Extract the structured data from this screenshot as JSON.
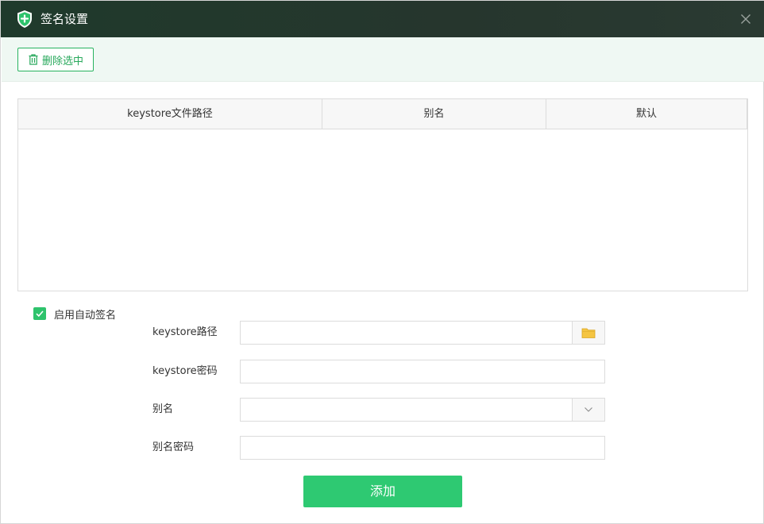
{
  "window": {
    "title": "签名设置"
  },
  "toolbar": {
    "delete_label": "删除选中"
  },
  "table": {
    "columns": [
      "keystore文件路径",
      "别名",
      "默认"
    ],
    "rows": []
  },
  "auto_sign": {
    "label": "启用自动签名",
    "checked": true
  },
  "form": {
    "keystore_path": {
      "label": "keystore路径",
      "value": "",
      "placeholder": ""
    },
    "keystore_password": {
      "label": "keystore密码",
      "value": "",
      "placeholder": ""
    },
    "alias": {
      "label": "别名",
      "selected": ""
    },
    "alias_password": {
      "label": "别名密码",
      "value": "",
      "placeholder": ""
    }
  },
  "actions": {
    "add_label": "添加"
  },
  "icons": {
    "title": "shield-plus-icon",
    "close": "close-icon",
    "delete": "trash-icon",
    "browse": "folder-icon",
    "dropdown": "chevron-down-icon",
    "check": "check-icon"
  },
  "colors": {
    "titlebar": "#26362d",
    "accent": "#2ec972",
    "toolbar_bg": "#eff8f3",
    "folder": "#f5c542"
  }
}
